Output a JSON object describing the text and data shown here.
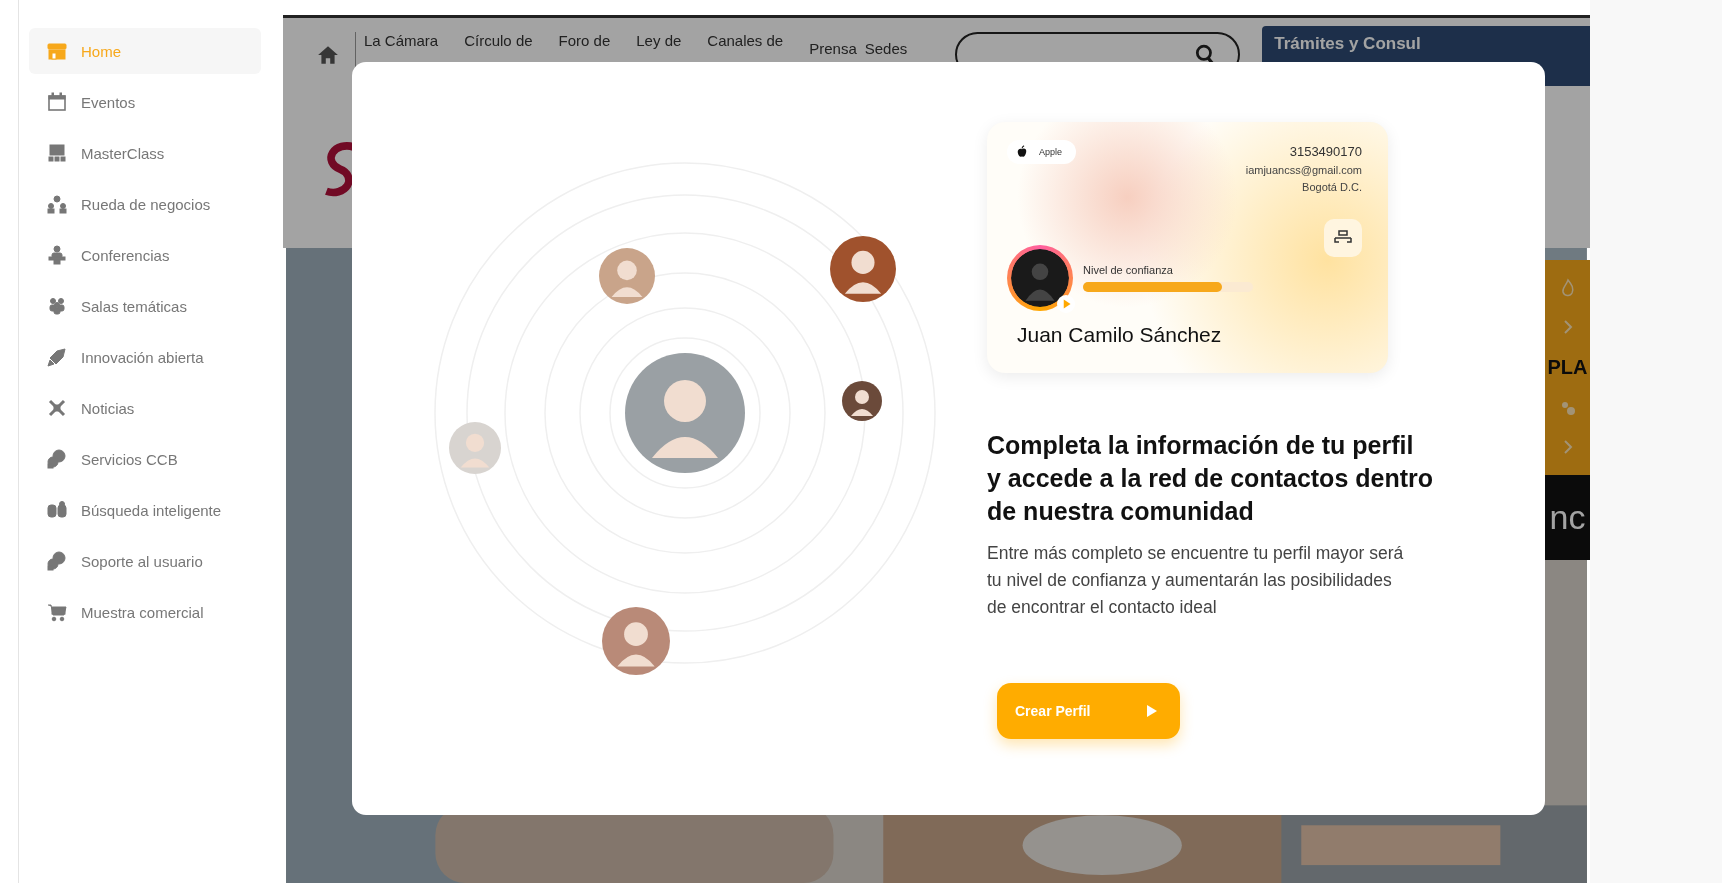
{
  "sidebar": {
    "items": [
      {
        "label": "Home",
        "selected": true
      },
      {
        "label": "Eventos",
        "selected": false
      },
      {
        "label": "MasterClass",
        "selected": false
      },
      {
        "label": "Rueda de negocios",
        "selected": false
      },
      {
        "label": "Conferencias",
        "selected": false
      },
      {
        "label": "Salas temáticas",
        "selected": false
      },
      {
        "label": "Innovación abierta",
        "selected": false
      },
      {
        "label": "Noticias",
        "selected": false
      },
      {
        "label": "Servicios CCB",
        "selected": false
      },
      {
        "label": "Búsqueda inteligente",
        "selected": false
      },
      {
        "label": "Soporte al usuario",
        "selected": false
      },
      {
        "label": "Muestra comercial",
        "selected": false
      }
    ]
  },
  "background_page": {
    "nav": {
      "items": [
        "La Cámara",
        "Círculo de",
        "Foro de",
        "Ley de",
        "Canales de",
        "Prensa",
        "Sedes"
      ],
      "button": "Trámites y Consul"
    },
    "side_panel": {
      "text": "PLA"
    },
    "banner": {
      "text": "nc"
    }
  },
  "modal": {
    "card": {
      "brand": "Apple",
      "phone": "3153490170",
      "email": "iamjuancss@gmail.com",
      "city": "Bogotá D.C.",
      "trust_label": "Nivel de confianza",
      "level": 0.82,
      "name": "Juan Camilo Sánchez"
    },
    "heading": "Completa la información de tu perfil\ny accede a la red de contactos dentro\nde nuestra comunidad",
    "text": "Entre más completo se encuentre tu perfil mayor será\ntu nivel de confianza y aumentarán las posibilidades\nde encontrar el contacto ideal",
    "button": "Crear Perfil"
  }
}
